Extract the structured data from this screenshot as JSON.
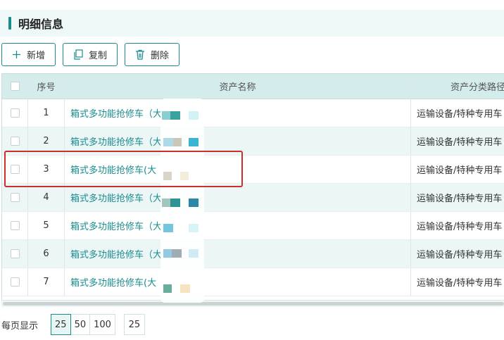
{
  "section": {
    "title": "明细信息"
  },
  "toolbar": {
    "add_label": "新增",
    "copy_label": "复制",
    "delete_label": "删除"
  },
  "table": {
    "headers": {
      "index": "序号",
      "name": "资产名称",
      "path": "资产分类路径"
    },
    "rows": [
      {
        "index": "1",
        "name": "箱式多功能抢修车（大",
        "path": "运输设备/特种专用车"
      },
      {
        "index": "2",
        "name": "箱式多功能抢修车（大",
        "path": "运输设备/特种专用车"
      },
      {
        "index": "3",
        "name": "箱式多功能抢修车(大",
        "path": "运输设备/特种专用车"
      },
      {
        "index": "4",
        "name": "箱式多功能抢修车（大",
        "path": "运输设备/特种专用车"
      },
      {
        "index": "5",
        "name": "箱式多功能抢修车（大",
        "path": "运输设备/特种专用车"
      },
      {
        "index": "6",
        "name": "箱式多功能抢修车（大",
        "path": "运输设备/特种专用车"
      },
      {
        "index": "7",
        "name": "箱式多功能抢修车(大",
        "path": "运输设备/特种专用车"
      }
    ]
  },
  "pager": {
    "label": "每页显示",
    "sizes": [
      "25",
      "50",
      "100"
    ],
    "selected": "25",
    "input_value": "25"
  },
  "colors": {
    "accent": "#1a8c8c",
    "highlight": "#c8302c",
    "header_bg": "#d4ecec",
    "alt_row": "#ecf6f6"
  }
}
